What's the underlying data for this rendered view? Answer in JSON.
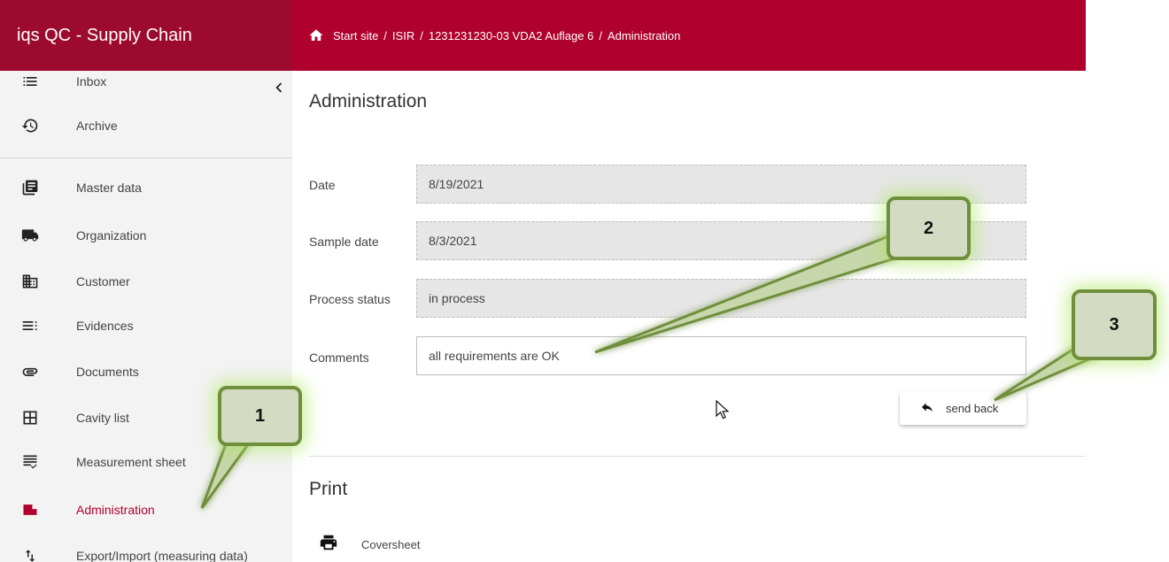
{
  "app": {
    "title": "iqs QC - Supply Chain"
  },
  "breadcrumb": {
    "items": [
      "Start site",
      "ISIR",
      "1231231230-03 VDA2 Auflage 6",
      "Administration"
    ],
    "separator": "/"
  },
  "sidebar": {
    "collapse_icon": "chevron-left-icon",
    "items": [
      {
        "label": "Inbox",
        "icon": "list-icon"
      },
      {
        "label": "Archive",
        "icon": "history-icon"
      },
      {
        "label": "Master data",
        "icon": "library-books-icon"
      },
      {
        "label": "Organization",
        "icon": "truck-icon"
      },
      {
        "label": "Customer",
        "icon": "business-icon"
      },
      {
        "label": "Evidences",
        "icon": "checklist-icon"
      },
      {
        "label": "Documents",
        "icon": "paperclip-icon"
      },
      {
        "label": "Cavity list",
        "icon": "grid-icon"
      },
      {
        "label": "Measurement sheet",
        "icon": "measurement-sheet-icon"
      },
      {
        "label": "Administration",
        "icon": "note-icon",
        "active": true
      },
      {
        "label": "Export/Import (measuring data)",
        "icon": "import-export-icon"
      }
    ]
  },
  "main": {
    "title": "Administration",
    "fields": {
      "date": {
        "label": "Date",
        "value": "8/19/2021"
      },
      "sample_date": {
        "label": "Sample date",
        "value": "8/3/2021"
      },
      "process_status": {
        "label": "Process status",
        "value": "in process"
      },
      "comments": {
        "label": "Comments",
        "value": "all requirements are OK"
      }
    },
    "send_back_label": "send back",
    "print": {
      "title": "Print",
      "items": [
        {
          "label": "Coversheet",
          "icon": "printer-icon"
        }
      ]
    }
  },
  "callouts": [
    "1",
    "2",
    "3"
  ],
  "colors": {
    "brand": "#9d0a2f",
    "topbar": "#b0002d",
    "active": "#b0002d",
    "callout_fill": "#d3dcc2",
    "callout_border": "#6f8f3c"
  }
}
